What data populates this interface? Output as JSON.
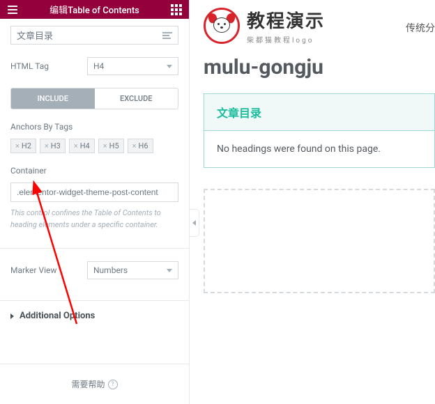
{
  "panel": {
    "header_title": "编辑Table of Contents",
    "title_input": "文章目录",
    "html_tag_label": "HTML Tag",
    "html_tag_value": "H4",
    "tabs": {
      "include": "INCLUDE",
      "exclude": "EXCLUDE"
    },
    "anchors_label": "Anchors By Tags",
    "anchor_tags": [
      "H2",
      "H3",
      "H4",
      "H5",
      "H6"
    ],
    "container_label": "Container",
    "container_value": ".elementor-widget-theme-post-content",
    "container_desc": "This control confines the Table of Contents to heading elements under a specific container.",
    "marker_label": "Marker View",
    "marker_value": "Numbers",
    "accordion_title": "Additional Options",
    "footer_help": "需要帮助"
  },
  "main": {
    "brand_title": "教程演示",
    "brand_sub": "柴都猫教程logo",
    "nav_item": "传统分",
    "page_title": "mulu-gongju",
    "toc_title": "文章目录",
    "toc_empty": "No headings were found on this page."
  }
}
